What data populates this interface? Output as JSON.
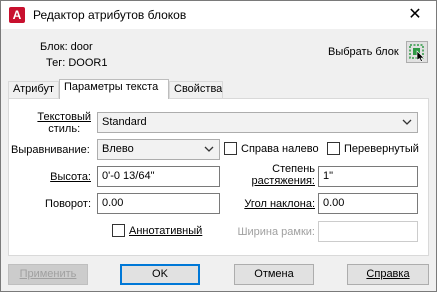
{
  "window": {
    "title": "Редактор атрибутов блоков",
    "app_icon_letter": "A",
    "close_glyph": "✕"
  },
  "block_info": {
    "block_label": "Блок: door",
    "tag_label": "Тег: DOOR1"
  },
  "pick_block": {
    "label": "Выбрать блок",
    "icon": "pick-block-icon"
  },
  "tabs": [
    {
      "label": "Атрибут",
      "active": false
    },
    {
      "label": "Параметры текста",
      "active": true
    },
    {
      "label": "Свойства",
      "active": false
    }
  ],
  "text_options": {
    "text_style": {
      "label_line1": "Текстовый",
      "label_line2": "стиль:",
      "value": "Standard"
    },
    "justification": {
      "label": "Выравнивание:",
      "value": "Влево"
    },
    "backwards": {
      "label": "Справа налево",
      "checked": false
    },
    "upside_down": {
      "label": "Перевернутый",
      "checked": false
    },
    "height": {
      "label": "Высота:",
      "value": "0'-0 13/64\""
    },
    "width_factor": {
      "label_line1": "Степень",
      "label_line2": "растяжения:",
      "value": "1\""
    },
    "rotation": {
      "label": "Поворот:",
      "value": "0.00"
    },
    "oblique": {
      "label": "Угол наклона:",
      "value": "0.00"
    },
    "annotative": {
      "label": "Аннотативный",
      "checked": false
    },
    "boundary_width": {
      "label": "Ширина рамки:",
      "value": "",
      "disabled": true
    }
  },
  "buttons": {
    "apply": "Применить",
    "ok": "OK",
    "cancel": "Отмена",
    "help": "Справка"
  },
  "colors": {
    "accent": "#0078d7",
    "app_icon": "#c8102e",
    "pick_icon_green": "#2e9a44"
  }
}
